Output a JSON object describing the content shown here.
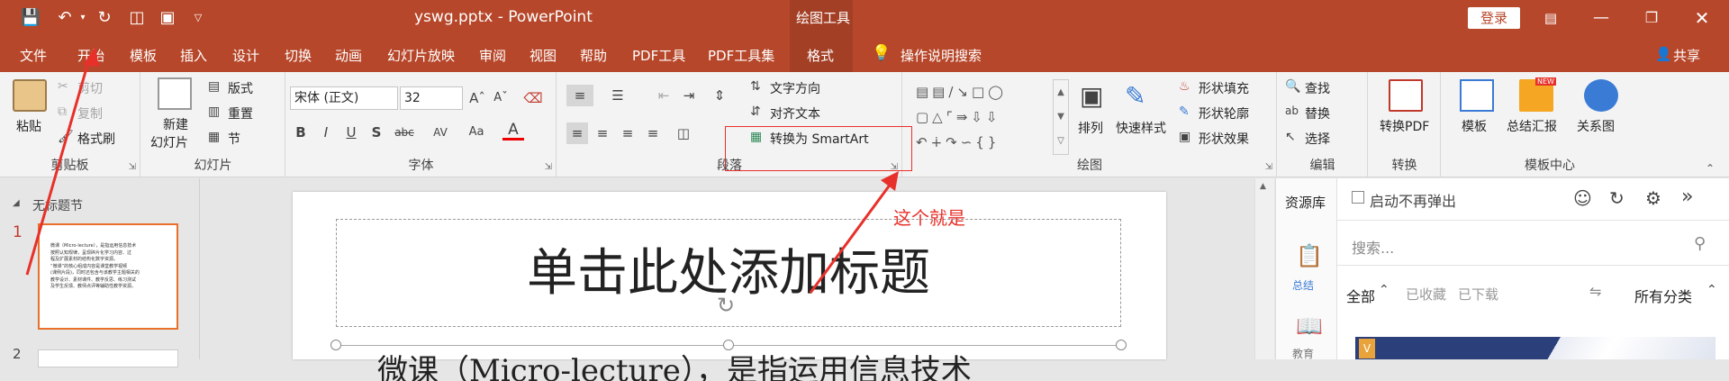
{
  "titlebar": {
    "doc_title": "yswg.pptx  -  PowerPoint",
    "context_label": "绘图工具",
    "login": "登录"
  },
  "tabs": [
    "文件",
    "开始",
    "模板",
    "插入",
    "设计",
    "切换",
    "动画",
    "幻灯片放映",
    "审阅",
    "视图",
    "帮助",
    "PDF工具",
    "PDF工具集",
    "格式"
  ],
  "tell_me": "操作说明搜索",
  "share": "共享",
  "ribbon": {
    "clipboard": {
      "paste": "粘贴",
      "cut": "剪切",
      "copy": "复制",
      "format_painter": "格式刷",
      "label": "剪贴板"
    },
    "slides": {
      "new_slide_line1": "新建",
      "new_slide_line2": "幻灯片",
      "layout": "版式",
      "reset": "重置",
      "section": "节",
      "label": "幻灯片"
    },
    "font": {
      "name": "宋体 (正文)",
      "size": "32",
      "label": "字体",
      "bold": "B",
      "italic": "I",
      "underline": "U",
      "shadow": "S",
      "strike": "abc",
      "spacing": "AV",
      "case": "Aa",
      "color": "A"
    },
    "paragraph": {
      "text_direction": "文字方向",
      "align_text": "对齐文本",
      "smartart": "转换为 SmartArt",
      "label": "段落"
    },
    "drawing": {
      "arrange": "排列",
      "quick_styles": "快速样式",
      "shape_fill": "形状填充",
      "shape_outline": "形状轮廓",
      "shape_effects": "形状效果",
      "label": "绘图"
    },
    "editing": {
      "find": "查找",
      "replace": "替换",
      "select": "选择",
      "label": "编辑"
    },
    "convert": {
      "to_pdf": "转换PDF",
      "label": "转换"
    },
    "template_center": {
      "template": "模板",
      "summary": "总结汇报",
      "relation": "关系图",
      "label": "模板中心",
      "new_badge": "NEW"
    }
  },
  "left_pane": {
    "section_title": "无标题节",
    "slide1_num": "1",
    "slide2_num": "2",
    "thumb_lines": [
      "微课（Micro-lecture），是指运用信息技术",
      "按照认知规律，呈现碎片化学习内容、过",
      "程及扩展素材的结构化数字资源。",
      "“微课”的核心组成内容是课堂教学视频",
      "(课例片段)，同时还包含与该教学主题相关的",
      "教学设计、素材课件、教学反思、练习测试",
      "及学生反馈、教师点评等辅助性教学资源。"
    ]
  },
  "slide": {
    "title_placeholder": "单击此处添加标题",
    "body_text": "微课（Micro-lecture），是指运用信息技术"
  },
  "annotation": {
    "text": "这个就是"
  },
  "right_nav": {
    "library": "资源库",
    "summary": "总结",
    "education": "教育"
  },
  "right_panel": {
    "no_popup": "启动不再弹出",
    "search_placeholder": "搜索...",
    "filter_all": "全部",
    "filter_fav": "已收藏",
    "filter_dl": "已下载",
    "category": "所有分类",
    "card_badge": "V"
  },
  "colors": {
    "accent": "#b7472a",
    "annotation": "#e8302a"
  }
}
